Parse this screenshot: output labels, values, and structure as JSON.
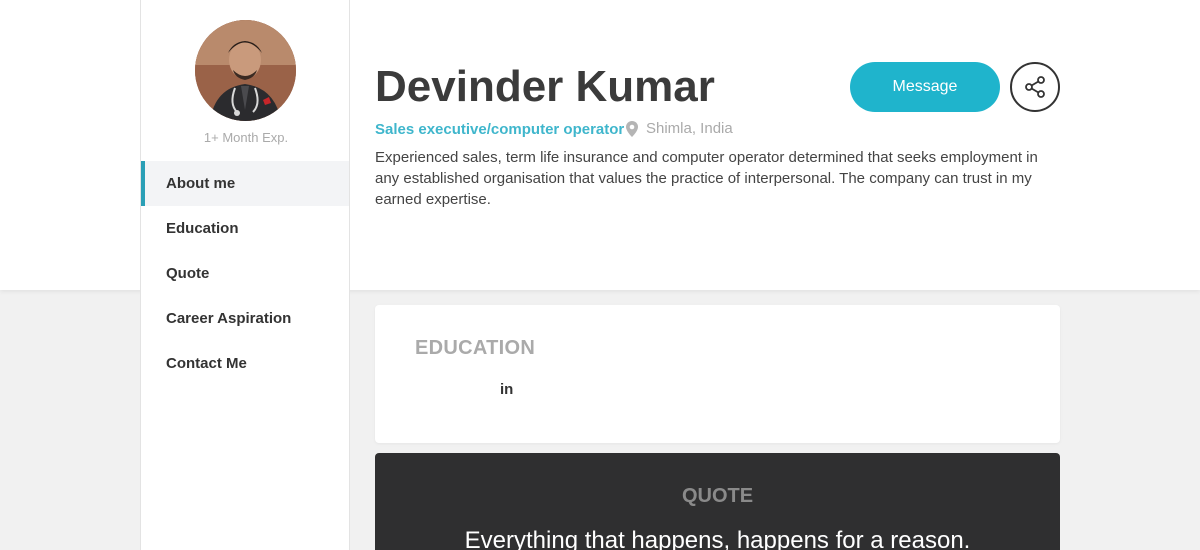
{
  "profile": {
    "name": "Devinder Kumar",
    "experience": "1+ Month Exp.",
    "role": "Sales executive/computer operator",
    "location": "Shimla, India",
    "bio": "Experienced sales, term life insurance and computer operator determined that seeks employment in any established organisation that values the practice of interpersonal. The company can trust in my earned expertise."
  },
  "actions": {
    "message_label": "Message",
    "share_icon": "share-icon"
  },
  "nav": {
    "items": [
      {
        "label": "About me",
        "active": true
      },
      {
        "label": "Education"
      },
      {
        "label": "Quote"
      },
      {
        "label": "Career Aspiration"
      },
      {
        "label": "Contact Me"
      }
    ]
  },
  "education": {
    "title": "EDUCATION",
    "entry_in": "in"
  },
  "quote": {
    "title": "QUOTE",
    "text": "Everything that happens, happens for a reason."
  },
  "colors": {
    "accent": "#1fb4cc",
    "accent_text": "#3fb6cc",
    "dark_card": "#2f2f30",
    "background": "#f1f1f1"
  }
}
